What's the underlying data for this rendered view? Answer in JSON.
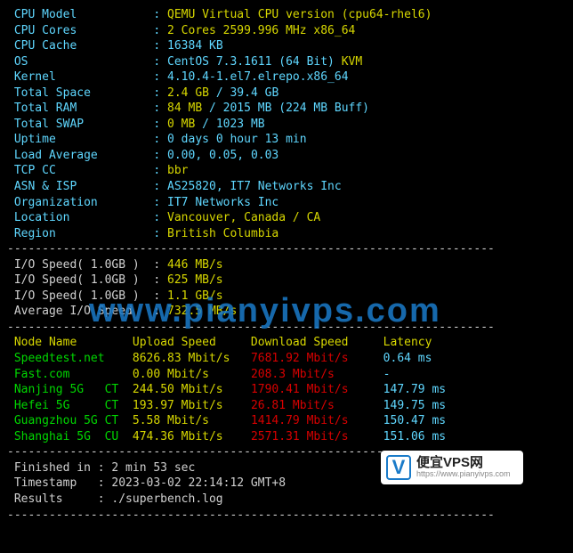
{
  "colors": {
    "cyan": "#5fd7ff",
    "yellow": "#d7d700",
    "green": "#00d700",
    "red": "#d70000"
  },
  "sysinfo": {
    "cpu_model_label": "CPU Model",
    "cpu_model": "QEMU Virtual CPU version (cpu64-rhel6)",
    "cpu_cores_label": "CPU Cores",
    "cpu_cores": "2 Cores 2599.996 MHz x86_64",
    "cpu_cache_label": "CPU Cache",
    "cpu_cache": "16384 KB",
    "os_label": "OS",
    "os_value": "CentOS 7.3.1611 (64 Bit)",
    "os_suffix": " KVM",
    "kernel_label": "Kernel",
    "kernel": "4.10.4-1.el7.elrepo.x86_64",
    "total_space_label": "Total Space",
    "total_space_used": "2.4 GB",
    "total_space_total": "39.4 GB",
    "total_ram_label": "Total RAM",
    "total_ram_used": "84 MB",
    "total_ram_total": "2015 MB",
    "total_ram_buff": "(224 MB Buff)",
    "total_swap_label": "Total SWAP",
    "total_swap_used": "0 MB",
    "total_swap_total": "1023 MB",
    "uptime_label": "Uptime",
    "uptime": "0 days 0 hour 13 min",
    "load_label": "Load Average",
    "load": "0.00, 0.05, 0.03",
    "tcp_label": "TCP CC",
    "tcp": "bbr",
    "asn_label": "ASN & ISP",
    "asn": "AS25820, IT7 Networks Inc",
    "org_label": "Organization",
    "org": "IT7 Networks Inc",
    "loc_label": "Location",
    "loc": "Vancouver, Canada / CA",
    "region_label": "Region",
    "region": "British Columbia"
  },
  "io": {
    "test1_label": "I/O Speed( 1.0GB )",
    "test1": "446 MB/s",
    "test2_label": "I/O Speed( 1.0GB )",
    "test2": "625 MB/s",
    "test3_label": "I/O Speed( 1.0GB )",
    "test3": "1.1 GB/s",
    "avg_label": "Average I/O Speed",
    "avg": "732.5 MB/s"
  },
  "speed": {
    "h_node": "Node Name",
    "h_up": "Upload Speed",
    "h_down": "Download Speed",
    "h_lat": "Latency",
    "rows": [
      {
        "name": "Speedtest.net",
        "up": "8626.83 Mbit/s",
        "down": "7681.92 Mbit/s",
        "lat": "0.64 ms"
      },
      {
        "name": "Fast.com",
        "up": "0.00 Mbit/s",
        "down": "208.3 Mbit/s",
        "lat": "-"
      },
      {
        "name": "Nanjing 5G   CT",
        "up": "244.50 Mbit/s",
        "down": "1790.41 Mbit/s",
        "lat": "147.79 ms"
      },
      {
        "name": "Hefei 5G     CT",
        "up": "193.97 Mbit/s",
        "down": "26.81 Mbit/s",
        "lat": "149.75 ms"
      },
      {
        "name": "Guangzhou 5G CT",
        "up": "5.58 Mbit/s",
        "down": "1414.79 Mbit/s",
        "lat": "150.47 ms"
      },
      {
        "name": "Shanghai 5G  CU",
        "up": "474.36 Mbit/s",
        "down": "2571.31 Mbit/s",
        "lat": "151.06 ms"
      }
    ]
  },
  "footer": {
    "finished_label": "Finished in",
    "finished": "2 min 53 sec",
    "ts_label": "Timestamp",
    "ts": "2023-03-02 22:14:12 GMT+8",
    "res_label": "Results",
    "res": "./superbench.log"
  },
  "watermark": "www.pianyivps.com",
  "badge": {
    "v": "V",
    "title": "便宜VPS网",
    "url": "https://www.pianyivps.com"
  },
  "divider": "----------------------------------------------------------------------"
}
